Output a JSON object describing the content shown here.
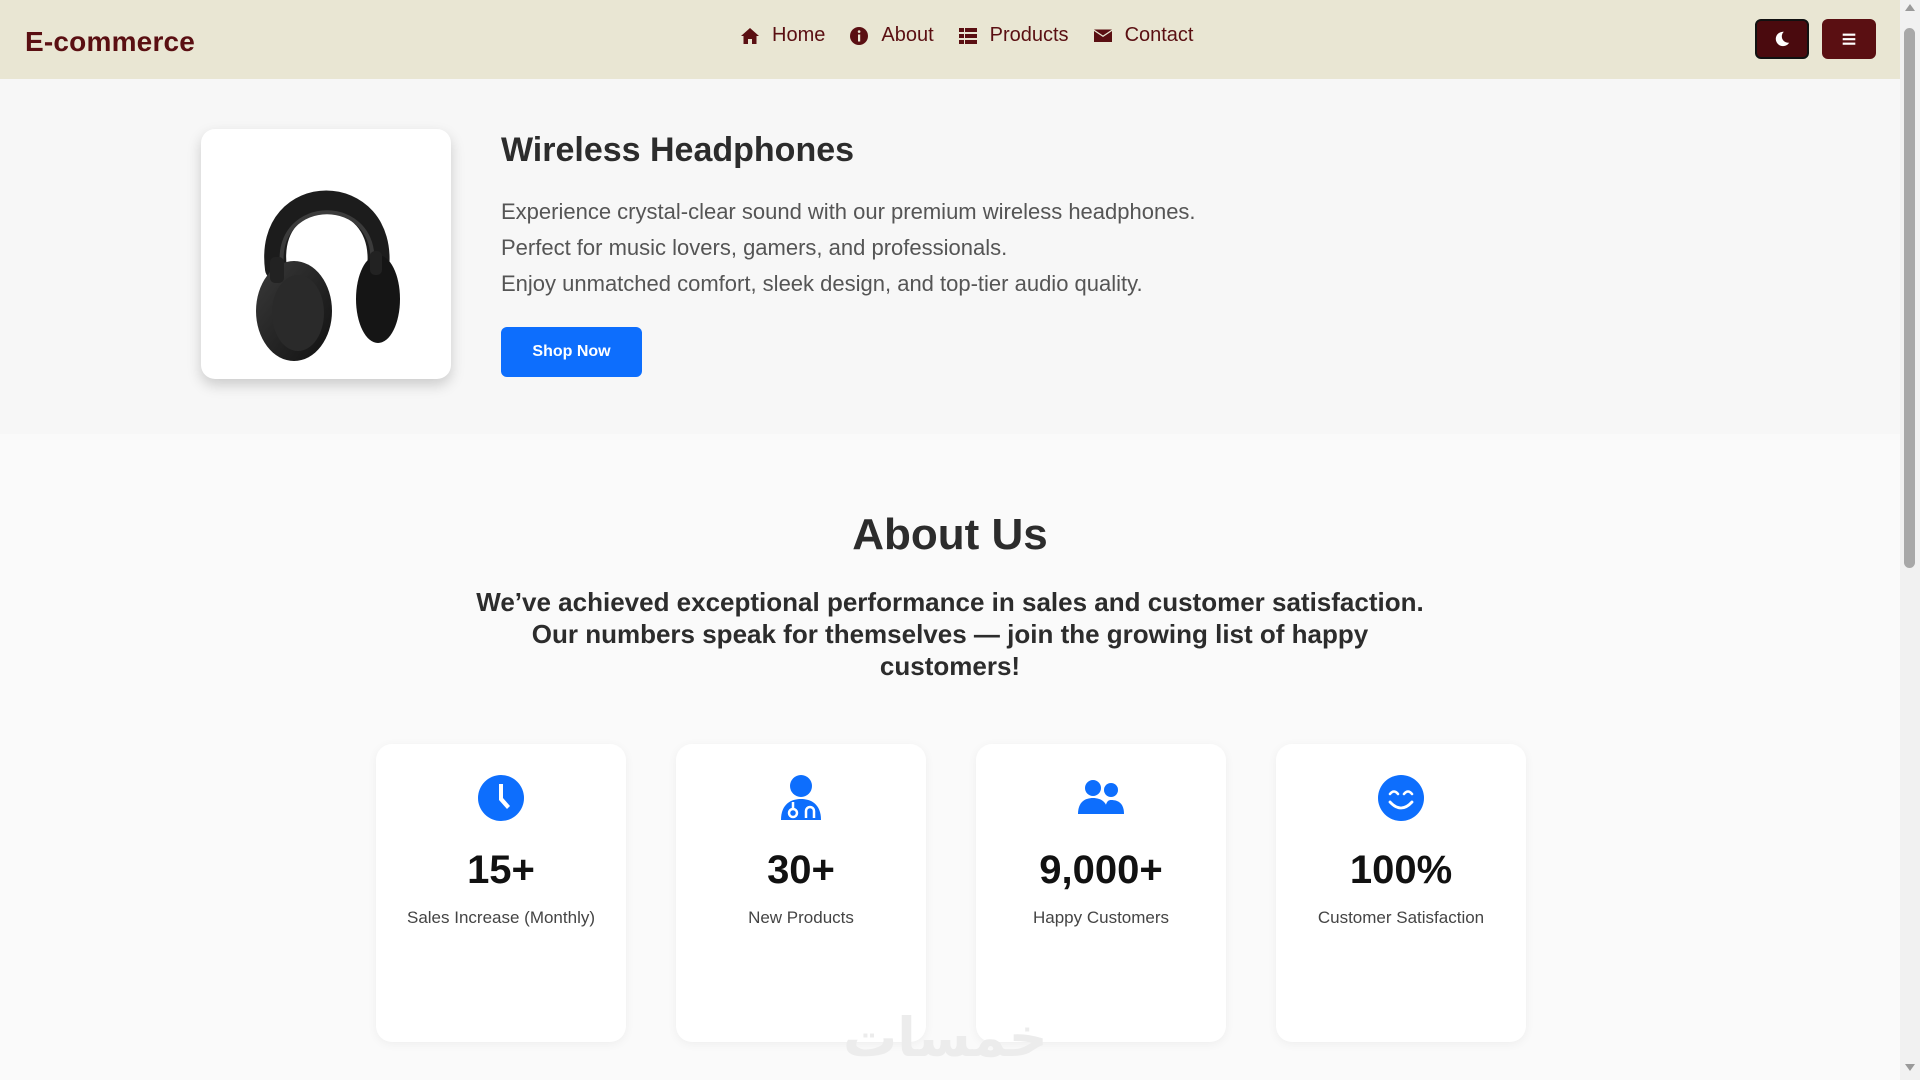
{
  "navbar": {
    "brand": "E-commerce",
    "links": [
      {
        "label": "Home",
        "icon": "home-icon"
      },
      {
        "label": "About",
        "icon": "info-icon"
      },
      {
        "label": "Products",
        "icon": "grid-list-icon"
      },
      {
        "label": "Contact",
        "icon": "envelope-icon"
      }
    ],
    "dark_mode_icon": "moon-icon",
    "menu_icon": "hamburger-icon"
  },
  "hero": {
    "title": "Wireless Headphones",
    "lines": [
      "Experience crystal-clear sound with our premium wireless headphones.",
      "Perfect for music lovers, gamers, and professionals.",
      "Enjoy unmatched comfort, sleek design, and top-tier audio quality."
    ],
    "cta_label": "Shop Now",
    "image_icon": "headphones-image"
  },
  "about": {
    "title": "About Us",
    "subtitle": "We’ve achieved exceptional performance in sales and customer satisfaction. Our numbers speak for themselves — join the growing list of happy customers!",
    "stats": [
      {
        "value": "15+",
        "label": "Sales Increase (Monthly)",
        "icon": "clock-icon"
      },
      {
        "value": "30+",
        "label": "New Products",
        "icon": "user-doctor-icon"
      },
      {
        "value": "9,000+",
        "label": "Happy Customers",
        "icon": "users-icon"
      },
      {
        "value": "100%",
        "label": "Customer Satisfaction",
        "icon": "smile-icon"
      }
    ]
  },
  "watermark": "خمسات",
  "colors": {
    "brand": "#5a0f12",
    "navbar_bg": "#e9e6d3",
    "accent": "#0d6efd"
  }
}
